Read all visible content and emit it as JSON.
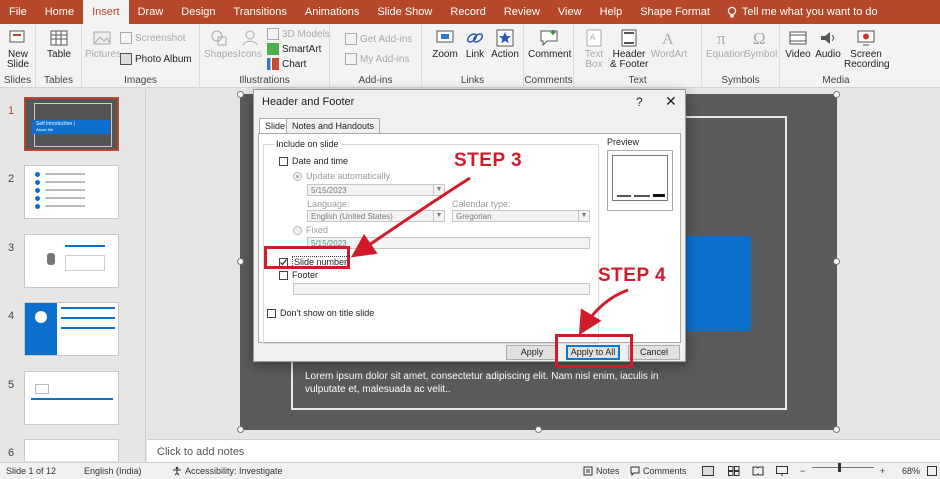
{
  "tabs": [
    "File",
    "Home",
    "Insert",
    "Draw",
    "Design",
    "Transitions",
    "Animations",
    "Slide Show",
    "Record",
    "Review",
    "View",
    "Help",
    "Shape Format"
  ],
  "active_tab": "Insert",
  "tell_me": "Tell me what you want to do",
  "ribbon": {
    "slides": {
      "new_slide": "New",
      "new_slide2": "Slide",
      "group": "Slides"
    },
    "tables": {
      "table": "Table",
      "group": "Tables"
    },
    "images": {
      "pictures": "Pictures",
      "screenshot": "Screenshot",
      "photo_album": "Photo Album",
      "group": "Images"
    },
    "illustrations": {
      "shapes": "Shapes",
      "icons": "Icons",
      "models": "3D Models",
      "smartart": "SmartArt",
      "chart": "Chart",
      "group": "Illustrations"
    },
    "addins": {
      "get": "Get Add-ins",
      "my": "My Add-ins",
      "group": "Add-ins"
    },
    "links": {
      "zoom": "Zoom",
      "link": "Link",
      "action": "Action",
      "group": "Links"
    },
    "comments": {
      "comment": "Comment",
      "group": "Comments"
    },
    "text": {
      "textbox1": "Text",
      "textbox2": "Box",
      "hf1": "Header",
      "hf2": "& Footer",
      "wordart": "WordArt",
      "group": "Text"
    },
    "symbols": {
      "equation": "Equation",
      "symbol": "Symbol",
      "group": "Symbols"
    },
    "media": {
      "video": "Video",
      "audio": "Audio",
      "rec1": "Screen",
      "rec2": "Recording",
      "group": "Media"
    }
  },
  "thumbnails": [
    {
      "num": "1",
      "title": "Self Introduction |",
      "sub": "About Me"
    },
    {
      "num": "2"
    },
    {
      "num": "3"
    },
    {
      "num": "4"
    },
    {
      "num": "5"
    },
    {
      "num": "6"
    }
  ],
  "slide": {
    "body": "Lorem ipsum dolor sit amet, consectetur adipiscing elit. Nam nisl enim, iaculis in vulputate et, malesuada ac velit.."
  },
  "notes_placeholder": "Click to add notes",
  "status": {
    "slide": "Slide 1 of 12",
    "language": "English (India)",
    "accessibility": "Accessibility: Investigate",
    "notes": "Notes",
    "comments": "Comments",
    "zoom": "68%"
  },
  "dialog": {
    "title": "Header and Footer",
    "help": "?",
    "close": "✕",
    "tab_slide": "Slide",
    "tab_notes": "Notes and Handouts",
    "include_on_slide": "Include on slide",
    "date_time": "Date and time",
    "update_auto": "Update automatically",
    "date_value": "5/15/2023",
    "language_label": "Language:",
    "language_value": "English (United States)",
    "calendar_label": "Calendar type:",
    "calendar_value": "Gregorian",
    "fixed": "Fixed",
    "fixed_value": "5/15/2023",
    "slide_number": "Slide number",
    "slide_number_checked": true,
    "footer": "Footer",
    "dont_show": "Don't show on title slide",
    "preview": "Preview",
    "apply": "Apply",
    "apply_all": "Apply to All",
    "cancel": "Cancel"
  },
  "annotations": {
    "step3": "STEP 3",
    "step4": "STEP 4"
  },
  "colors": {
    "accent": "#b7472a",
    "annotation": "#d11a2a",
    "slide_blue": "#0b6fce"
  }
}
